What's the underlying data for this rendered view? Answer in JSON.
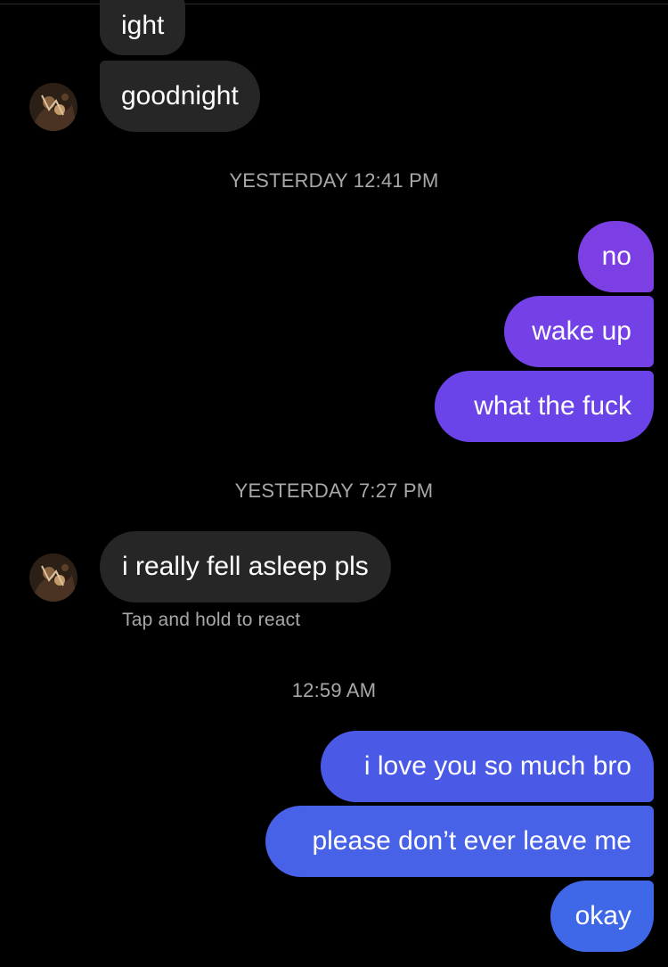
{
  "conversation": {
    "group1": {
      "messages": [
        "ight",
        "goodnight"
      ],
      "avatar_icon": "contact-avatar"
    },
    "timestamp1": "YESTERDAY 12:41 PM",
    "group2": {
      "messages": [
        "no",
        "wake up",
        "what the fuck"
      ],
      "colors": [
        "#7c3fe4",
        "#7341e6",
        "#6a44e8"
      ]
    },
    "timestamp2": "YESTERDAY 7:27 PM",
    "group3": {
      "messages": [
        "i really fell asleep pls"
      ],
      "hint": "Tap and hold to react",
      "avatar_icon": "contact-avatar"
    },
    "timestamp3": "12:59 AM",
    "group4": {
      "messages": [
        "i love you so much bro",
        "please don’t ever leave me",
        "okay"
      ],
      "colors": [
        "#4b5ae6",
        "#4761e7",
        "#3f68e8"
      ]
    },
    "incoming_bubble_color": "#262626",
    "background_color": "#000000"
  }
}
